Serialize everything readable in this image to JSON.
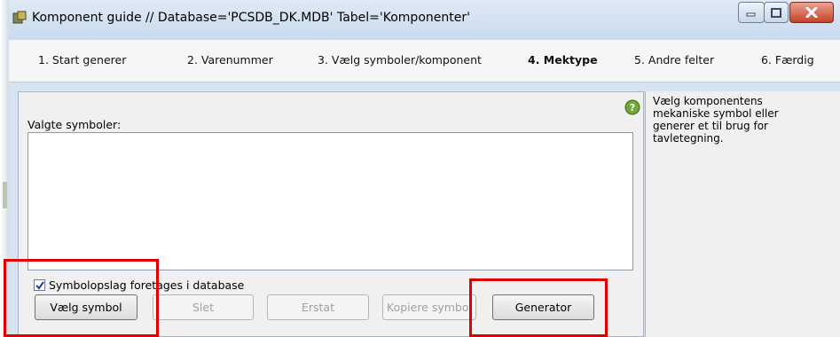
{
  "window": {
    "title": "Komponent guide  //  Database='PCSDB_DK.MDB' Tabel='Komponenter'",
    "controls": {
      "minimize": "minimize-icon",
      "maximize": "maximize-icon",
      "close": "close-icon"
    }
  },
  "tabs": [
    {
      "label": "1. Start generer"
    },
    {
      "label": "2. Varenummer"
    },
    {
      "label": "3. Vælg symboler/komponent"
    },
    {
      "label": "4. Mektype",
      "active": true
    },
    {
      "label": "5. Andre felter"
    },
    {
      "label": "6. Færdig"
    }
  ],
  "main": {
    "selected_label": "Valgte symboler:",
    "checkbox": {
      "label": "Symbolopslag foretages i database",
      "checked": true
    },
    "buttons": {
      "select": "Vælg symbol",
      "delete": "Slet",
      "replace": "Erstat",
      "copy": "Kopiere symbol",
      "generator": "Generator"
    }
  },
  "side": {
    "help_text": "Vælg komponentens mekaniske symbol eller generer et til brug for tavletegning."
  },
  "colors": {
    "highlight": "#e00000",
    "titlebar": "#c8daec",
    "close_button": "#c5432b",
    "help_icon": "#6fa832"
  }
}
